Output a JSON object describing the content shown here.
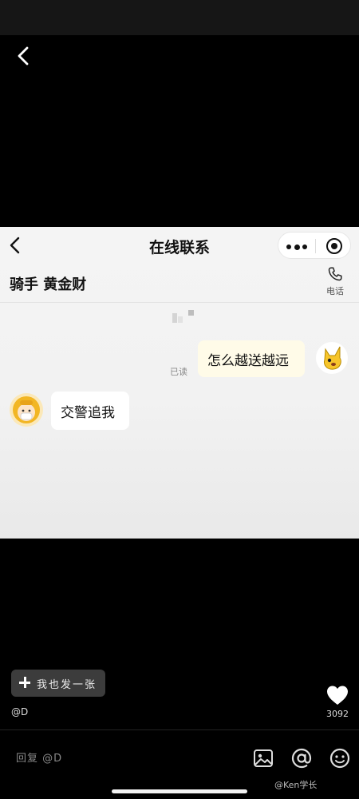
{
  "post": {
    "send_button_label": "我也发一张",
    "author": "@D",
    "like_count": "3092",
    "reply_placeholder": "回复 @D",
    "watermark": "@Ken学长"
  },
  "chat": {
    "title": "在线联系",
    "rider_name": "骑手 黄金财",
    "phone_label": "电话",
    "messages": [
      {
        "from": "self",
        "text": "怎么越送越远",
        "status": "已读"
      },
      {
        "from": "rider",
        "text": "交警追我"
      }
    ]
  },
  "icons": {
    "back": "chevron-left-icon",
    "more": "more-dots-icon",
    "close_miniprogram": "target-icon",
    "phone": "phone-icon",
    "like": "heart-icon",
    "image": "image-icon",
    "mention": "at-icon",
    "emoji": "emoji-icon"
  },
  "colors": {
    "background": "#000000",
    "chat_background": "#f4f4f4",
    "bubble_out": "#fffbe8",
    "bubble_in": "#ffffff"
  }
}
